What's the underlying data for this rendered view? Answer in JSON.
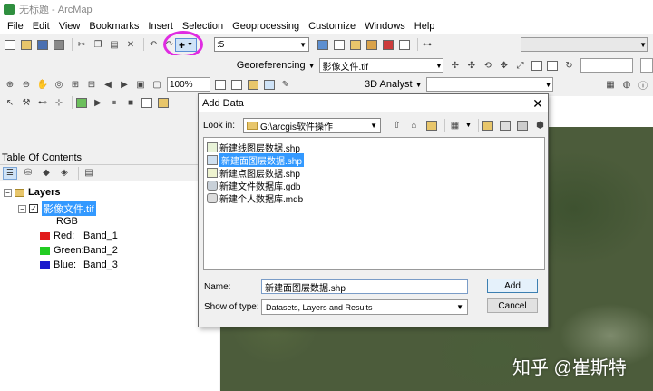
{
  "window": {
    "title": "无标题 - ArcMap"
  },
  "menubar": {
    "items": [
      "File",
      "Edit",
      "View",
      "Bookmarks",
      "Insert",
      "Selection",
      "Geoprocessing",
      "Customize",
      "Windows",
      "Help"
    ]
  },
  "toolbar": {
    "scale_value": ":5",
    "zoom_value": "100%",
    "georeferencing_label": "Georeferencing",
    "georef_layer": "影像文件.tif",
    "analyst_label": "3D Analyst"
  },
  "toc": {
    "header": "Table Of Contents",
    "layers_label": "Layers",
    "layer_name": "影像文件.tif",
    "rgb_label": "RGB",
    "bands": [
      {
        "channel": "Red:",
        "band": "Band_1",
        "color": "#e11b1b"
      },
      {
        "channel": "Green:",
        "band": "Band_2",
        "color": "#22cc22"
      },
      {
        "channel": "Blue:",
        "band": "Band_3",
        "color": "#1a1acc"
      }
    ]
  },
  "dialog": {
    "title": "Add Data",
    "look_in_label": "Look in:",
    "look_in_value": "G:\\arcgis软件操作",
    "files": [
      {
        "name": "新建线图层数据.shp",
        "icon": "line-shapefile-icon"
      },
      {
        "name": "新建面图层数据.shp",
        "icon": "polygon-shapefile-icon"
      },
      {
        "name": "新建点图层数据.shp",
        "icon": "point-shapefile-icon"
      },
      {
        "name": "新建文件数据库.gdb",
        "icon": "file-geodatabase-icon"
      },
      {
        "name": "新建个人数据库.mdb",
        "icon": "personal-geodatabase-icon"
      }
    ],
    "selected_file": "新建面图层数据.shp",
    "name_label": "Name:",
    "name_value": "新建面图层数据.shp",
    "type_label": "Show of type:",
    "type_value": "Datasets, Layers and Results",
    "add_button": "Add",
    "cancel_button": "Cancel"
  },
  "watermark": "知乎 @崔斯特",
  "colors": {
    "highlight_circle": "#e02be2",
    "selection": "#3399ff"
  }
}
